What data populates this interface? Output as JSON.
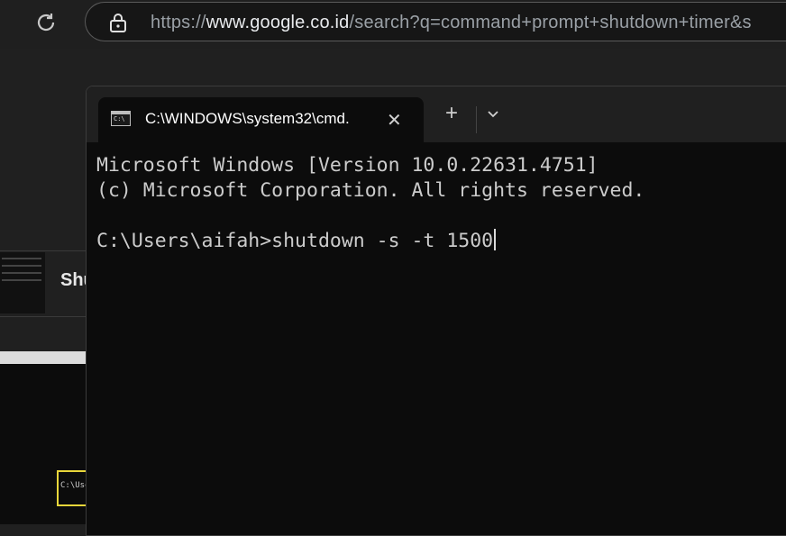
{
  "browser": {
    "url_prefix": "https://",
    "url_host": "www.google.co.id",
    "url_rest": "/search?q=command+prompt+shutdown+timer&s"
  },
  "background": {
    "result_title_partial": "Shu",
    "thumb_caption": "C:\\Use"
  },
  "terminal": {
    "tab_title": "C:\\WINDOWS\\system32\\cmd.",
    "new_tab_symbol": "+",
    "close_symbol": "✕",
    "lines": [
      "Microsoft Windows [Version 10.0.22631.4751]",
      "(c) Microsoft Corporation. All rights reserved.",
      "",
      "C:\\Users\\aifah>shutdown -s -t 1500"
    ]
  },
  "colors": {
    "terminal_bg": "#0c0c0c",
    "terminal_text": "#cccccc",
    "chrome_bg": "#202020"
  },
  "icons": [
    "reload-icon",
    "lock-icon",
    "cmd-icon",
    "close-icon",
    "plus-icon",
    "chevron-down-icon"
  ]
}
